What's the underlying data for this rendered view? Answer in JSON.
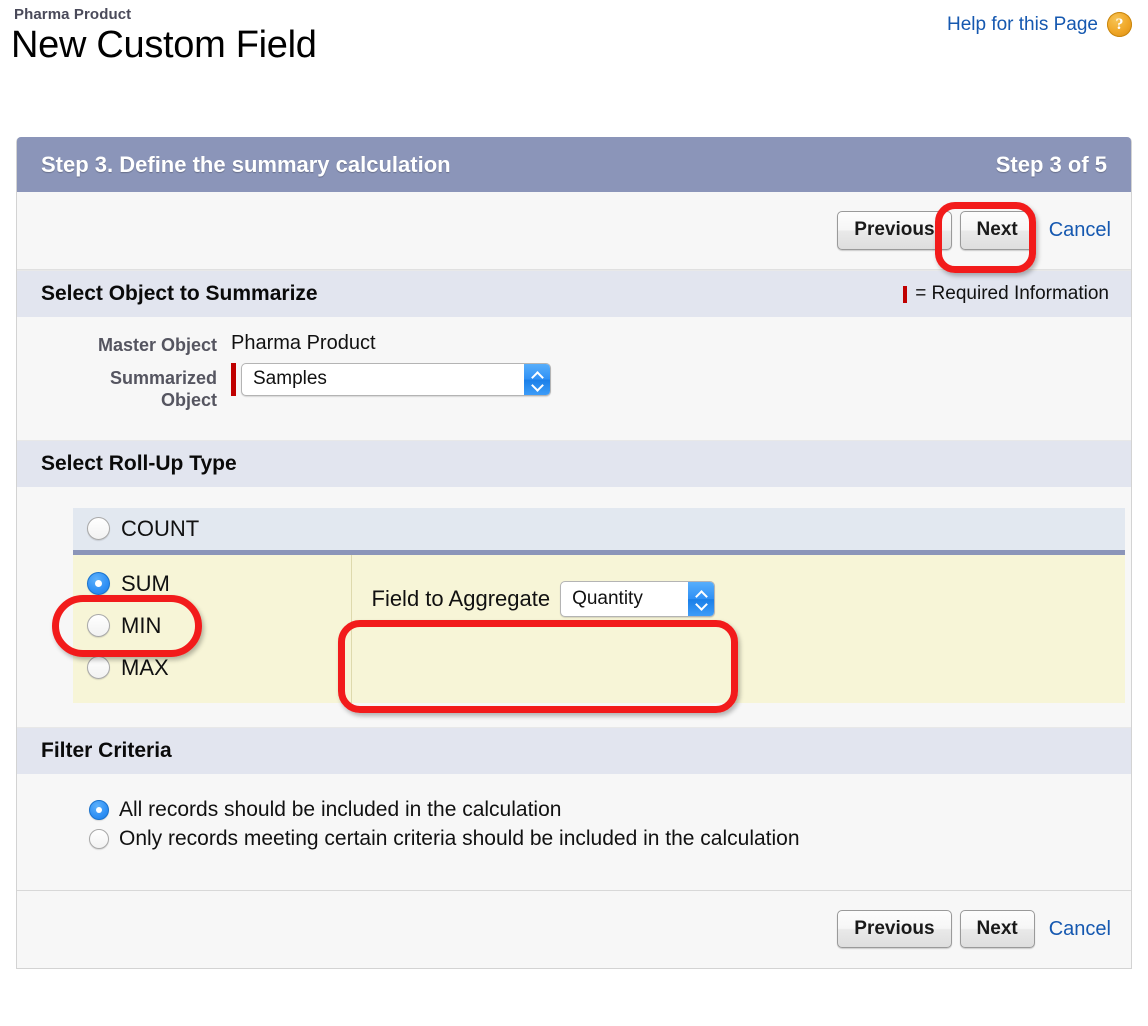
{
  "header": {
    "breadcrumb": "Pharma Product",
    "title": "New Custom Field",
    "help_link": "Help for this Page",
    "help_icon_glyph": "?"
  },
  "wizard": {
    "step_title": "Step 3. Define the summary calculation",
    "step_counter": "Step 3 of 5",
    "buttons": {
      "previous": "Previous",
      "next": "Next",
      "cancel": "Cancel"
    }
  },
  "select_object_section": {
    "heading": "Select Object to Summarize",
    "required_legend": "= Required Information",
    "master_object_label": "Master Object",
    "master_object_value": "Pharma Product",
    "summarized_object_label": "Summarized Object",
    "summarized_object_value": "Samples",
    "summarized_object_required": true
  },
  "rollup_section": {
    "heading": "Select Roll-Up Type",
    "options": [
      {
        "label": "COUNT",
        "selected": false
      },
      {
        "label": "SUM",
        "selected": true
      },
      {
        "label": "MIN",
        "selected": false
      },
      {
        "label": "MAX",
        "selected": false
      }
    ],
    "aggregate_label": "Field to Aggregate",
    "aggregate_value": "Quantity"
  },
  "filter_section": {
    "heading": "Filter Criteria",
    "options": [
      {
        "label": "All records should be included in the calculation",
        "selected": true
      },
      {
        "label": "Only records meeting certain criteria should be included in the calculation",
        "selected": false
      }
    ]
  },
  "colors": {
    "titlebar": "#8b95b9",
    "section_header": "#e2e5ef",
    "highlight_row": "#e2e8f0",
    "selected_row": "#f7f5d7",
    "annotation": "#f21b1b",
    "link": "#1558b0",
    "required": "#c00000"
  }
}
